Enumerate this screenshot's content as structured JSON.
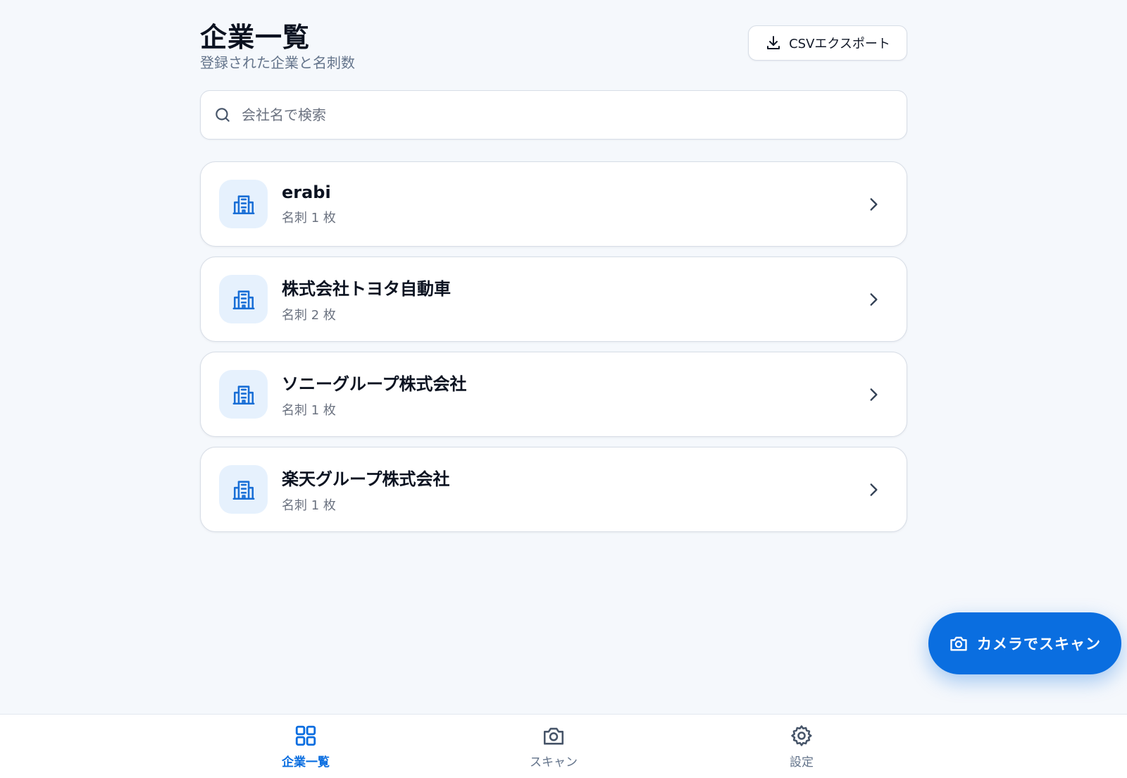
{
  "header": {
    "title": "企業一覧",
    "subtitle": "登録された企業と名刺数",
    "export_label": "CSVエクスポート",
    "export_icon": "download-icon"
  },
  "search": {
    "placeholder": "会社名で検索",
    "value": "",
    "icon": "search-icon"
  },
  "companies": [
    {
      "name": "erabi",
      "count": "名刺 1 枚",
      "icon": "building-icon"
    },
    {
      "name": "株式会社トヨタ自動車",
      "count": "名刺 2 枚",
      "icon": "building-icon"
    },
    {
      "name": "ソニーグループ株式会社",
      "count": "名刺 1 枚",
      "icon": "building-icon"
    },
    {
      "name": "楽天グループ株式会社",
      "count": "名刺 1 枚",
      "icon": "building-icon"
    }
  ],
  "fab": {
    "label": "カメラでスキャン",
    "icon": "camera-icon"
  },
  "bottom_nav": {
    "items": [
      {
        "label": "企業一覧",
        "icon": "grid-icon",
        "active": true
      },
      {
        "label": "スキャン",
        "icon": "camera-icon",
        "active": false
      },
      {
        "label": "設定",
        "icon": "gear-icon",
        "active": false
      }
    ]
  },
  "colors": {
    "accent": "#0a6ee0",
    "background": "#f5f8fc",
    "icon_tile": "#e6f1fd"
  }
}
